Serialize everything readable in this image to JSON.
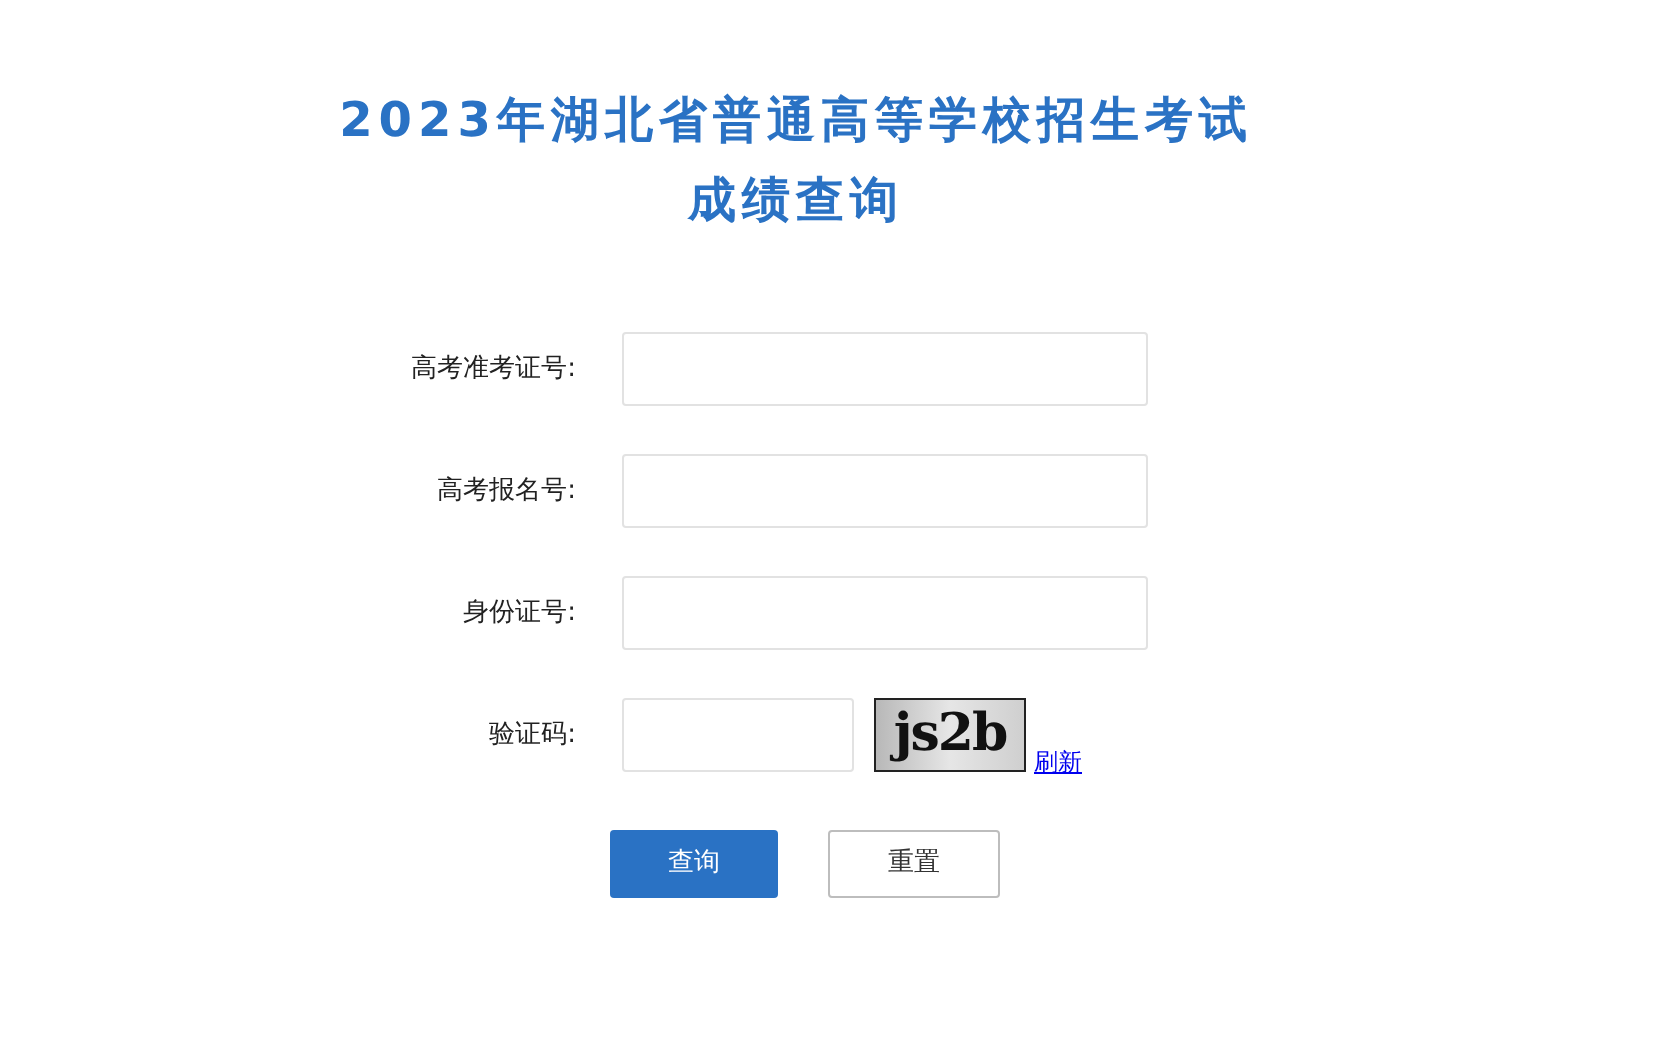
{
  "title": {
    "line_1": "2023年湖北省普通高等学校招生考试",
    "line_2": "成绩查询"
  },
  "fields": [
    {
      "label": "高考准考证号:",
      "kind": "text"
    },
    {
      "label": "高考报名号:",
      "kind": "text"
    },
    {
      "label": "身份证号:",
      "kind": "text"
    },
    {
      "label": "验证码:",
      "kind": "captcha"
    }
  ],
  "captcha": {
    "code": "js2b",
    "refresh_link": "刷新"
  },
  "buttons": [
    {
      "label": "查询",
      "kind": "primary"
    },
    {
      "label": "重置",
      "kind": "secondary"
    }
  ]
}
